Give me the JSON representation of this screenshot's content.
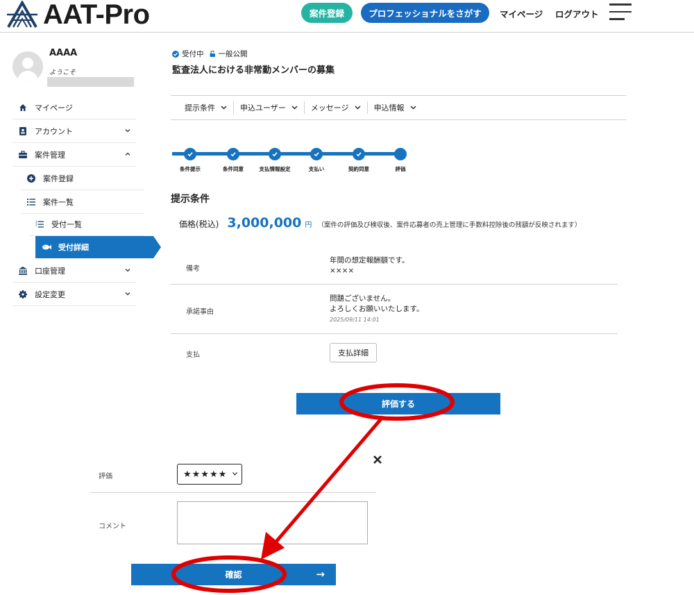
{
  "header": {
    "logo_text": "AAT-Pro",
    "buttons": [
      {
        "label": "案件登録",
        "color": "#27b3a4"
      },
      {
        "label": "プロフェッショナルをさがす",
        "color": "#1a6cc0"
      }
    ],
    "links": [
      "マイページ",
      "ログアウト"
    ]
  },
  "user": {
    "name": "AAAA",
    "welcome": "ようこそ"
  },
  "sidebar": {
    "items": [
      {
        "label": "マイページ",
        "icon": "home-icon"
      },
      {
        "label": "アカウント",
        "icon": "id-card-icon"
      },
      {
        "label": "案件管理",
        "icon": "briefcase-icon"
      },
      {
        "label": "案件登録",
        "icon": "plus-circle-icon"
      },
      {
        "label": "案件一覧",
        "icon": "list-icon"
      },
      {
        "label": "受付一覧",
        "icon": "ordered-list-icon"
      },
      {
        "label": "受付詳細",
        "icon": "fish-icon"
      },
      {
        "label": "口座管理",
        "icon": "bank-icon"
      },
      {
        "label": "設定変更",
        "icon": "gear-icon"
      }
    ]
  },
  "job": {
    "status": "受付中",
    "visibility": "一般公開",
    "title": "監査法人における非常勤メンバーの募集"
  },
  "tabs": [
    "提示条件",
    "申込ユーザー",
    "メッセージ",
    "申込情報"
  ],
  "steps": {
    "labels": [
      "条件提示",
      "条件同意",
      "支払情報設定",
      "支払い",
      "契約同意",
      "評価"
    ],
    "completed": 5,
    "current": 6
  },
  "terms": {
    "section_title": "提示条件",
    "price_label": "価格(税込)",
    "price_value": "3,000,000",
    "price_unit": "円",
    "price_note": "（案件の評価及び検収後、案件応募者の売上管理に手数料控除後の残額が反映されます）",
    "rows": [
      {
        "label": "備考",
        "lines": [
          "年間の想定報酬額です。",
          "××××"
        ]
      },
      {
        "label": "承諾事由",
        "lines": [
          "問題ございません。",
          "よろしくお願いいたします。"
        ],
        "timestamp": "2025/09/11 14:01"
      },
      {
        "label": "支払",
        "button": "支払詳細"
      }
    ]
  },
  "evaluate_button": "評価する",
  "review_form": {
    "rating_label": "評価",
    "rating_value": "★★★★★",
    "comment_label": "コメント",
    "comment_value": "",
    "confirm_button": "確認",
    "confirm_arrow": "→"
  },
  "annotation_color": "#e00000"
}
